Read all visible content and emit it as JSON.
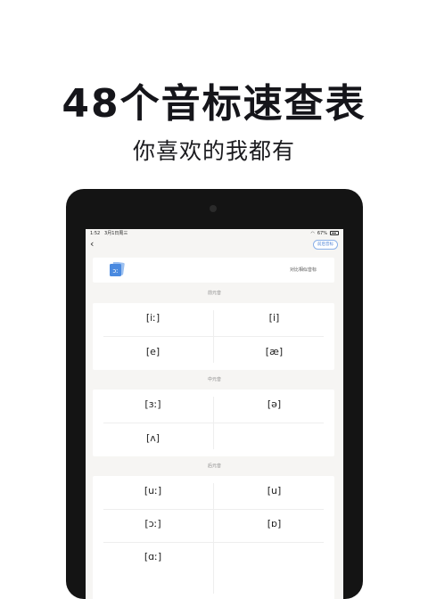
{
  "headline": "48个音标速查表",
  "subline": "你喜欢的我都有",
  "status": {
    "time": "1:52",
    "date": "3月1日周三",
    "wifi": "wifi-icon",
    "battery_pct": "67%",
    "battery_icon": "battery-icon"
  },
  "nav": {
    "back_icon": "chevron-left-icon",
    "compare_button": "前后音标"
  },
  "banner": {
    "icon": "flashcard-icon",
    "text": "对比相似音标"
  },
  "sections": [
    {
      "title": "前元音",
      "rows": [
        [
          "[iː]",
          "[i]"
        ],
        [
          "[e]",
          "[æ]"
        ]
      ]
    },
    {
      "title": "中元音",
      "rows": [
        [
          "[ɜː]",
          "[ə]"
        ],
        [
          "[ʌ]",
          ""
        ]
      ]
    },
    {
      "title": "后元音",
      "rows": [
        [
          "[uː]",
          "[u]"
        ],
        [
          "[ɔː]",
          "[ɒ]"
        ],
        [
          "[ɑː]",
          ""
        ]
      ]
    }
  ],
  "colors": {
    "accent": "#4a7fd4",
    "screen_bg": "#f6f5f3",
    "card_bg": "#ffffff"
  }
}
